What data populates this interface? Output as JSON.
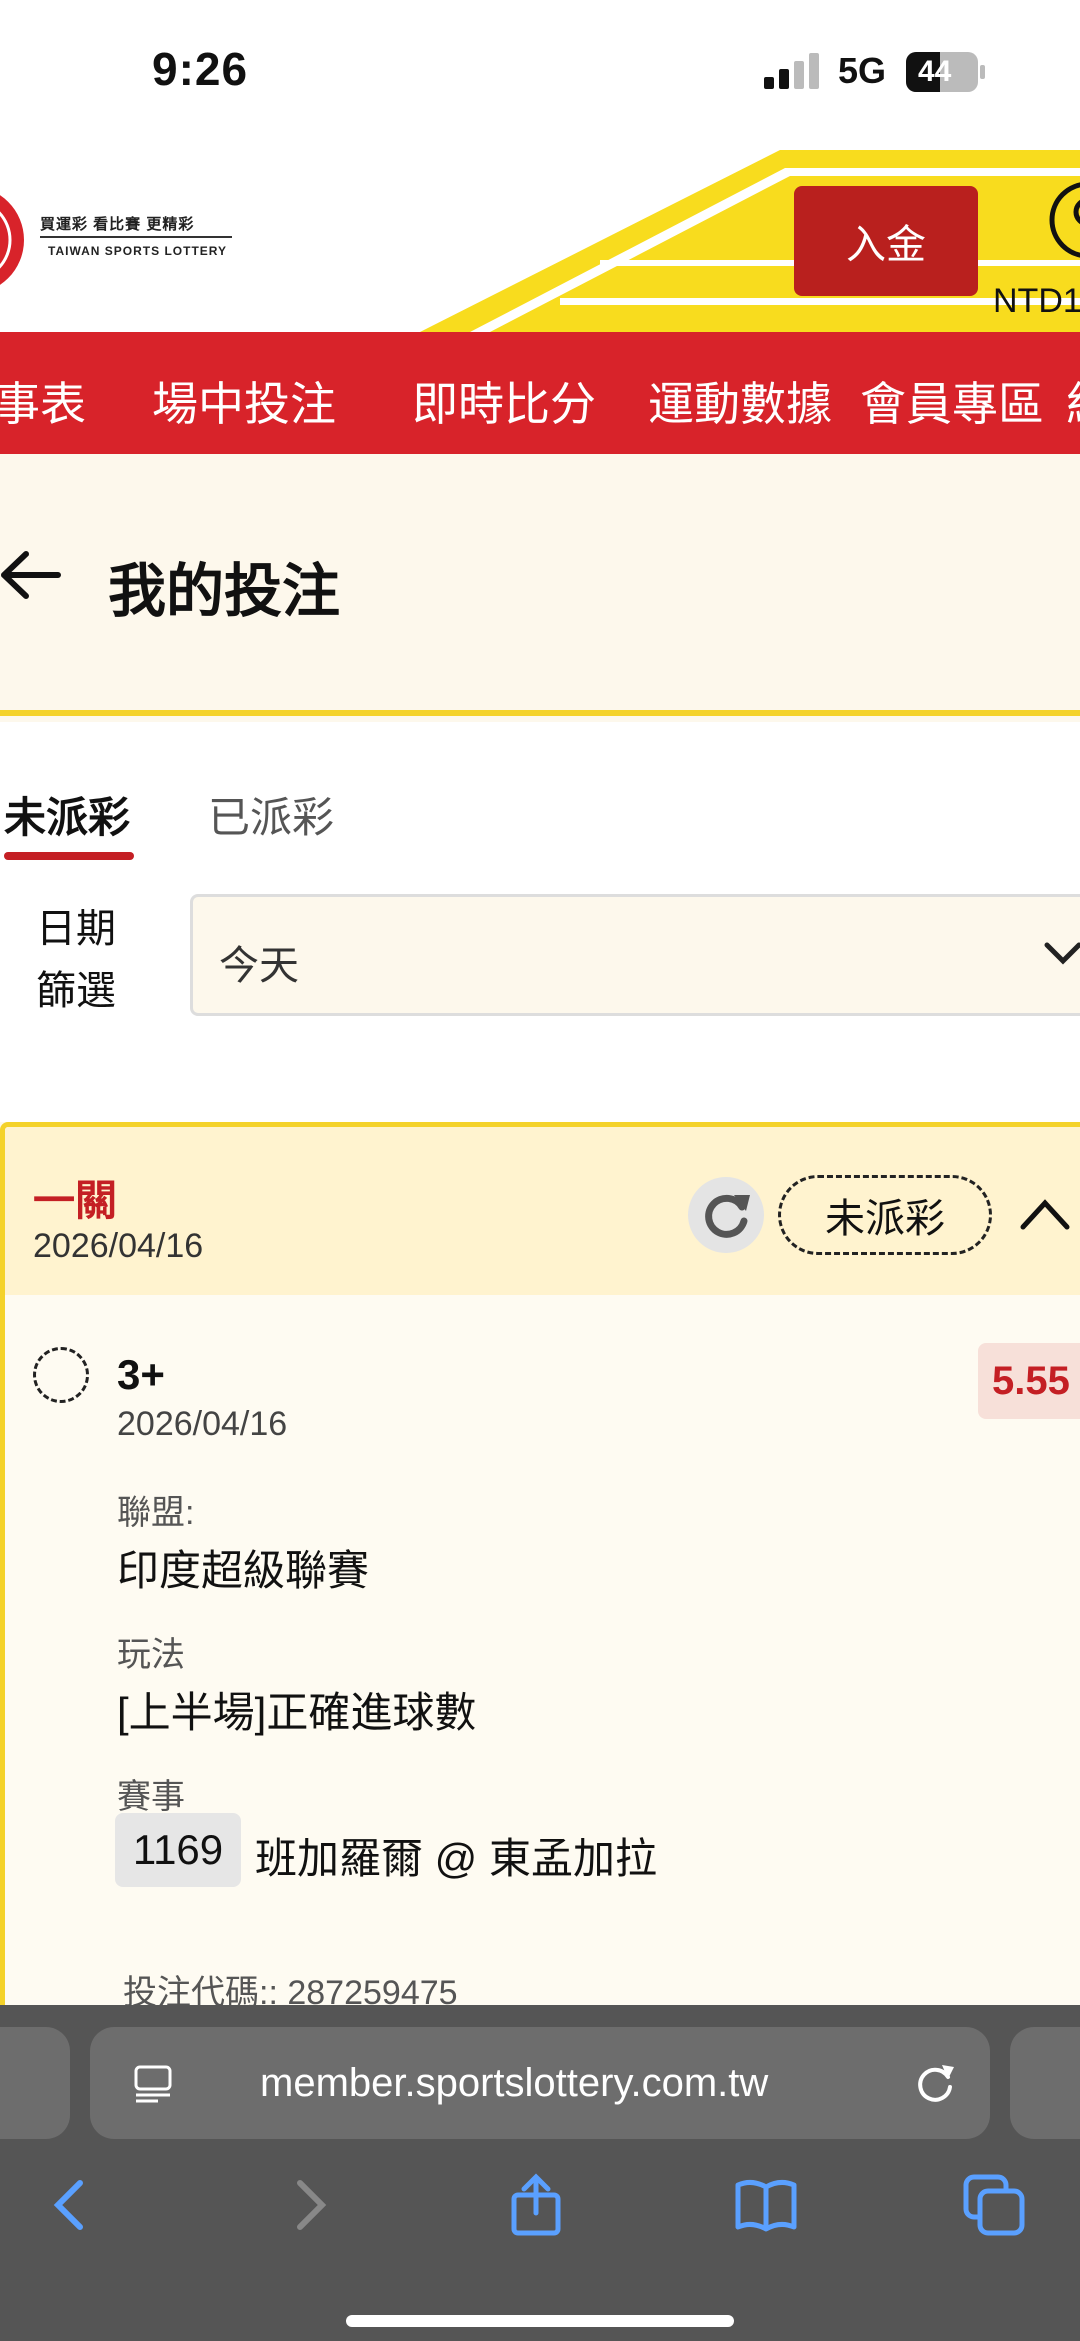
{
  "status_bar": {
    "time": "9:26",
    "network": "5G",
    "battery": "44"
  },
  "header": {
    "logo_slogan": "買運彩  看比賽  更精彩",
    "logo_en": "TAIWAN SPORTS LOTTERY",
    "deposit_label": "入金",
    "balance_label": "NTD1"
  },
  "nav": {
    "items": [
      "事表",
      "場中投注",
      "即時比分",
      "運動數據",
      "會員專區",
      "約"
    ]
  },
  "page": {
    "title": "我的投注"
  },
  "tabs": {
    "active": "未派彩",
    "inactive": "已派彩"
  },
  "filter": {
    "label_line1": "日期",
    "label_line2": "篩選",
    "value": "今天"
  },
  "bet": {
    "type": "一關",
    "date": "2026/04/16",
    "status": "未派彩",
    "selection": "3+",
    "selection_date": "2026/04/16",
    "odds": "5.55",
    "league_label": "聯盟:",
    "league": "印度超級聯賽",
    "market_label": "玩法",
    "market": "[上半場]正確進球數",
    "event_label": "賽事",
    "match_id": "1169",
    "match_name": "班加羅爾 @ 東孟加拉",
    "code_label": "投注代碼::",
    "code": "287259475"
  },
  "browser": {
    "url": "member.sportslottery.com.tw"
  },
  "colors": {
    "brand_red": "#d8232a",
    "accent_yellow": "#f4d22a",
    "deposit_red": "#b9201e"
  }
}
